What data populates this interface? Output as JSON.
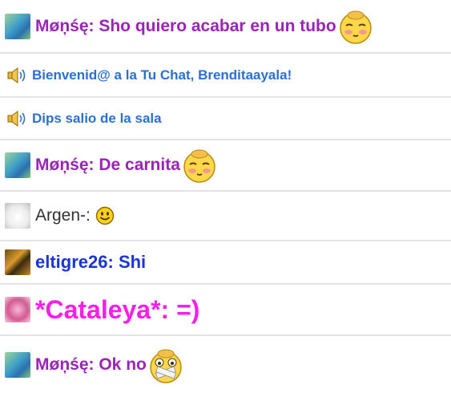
{
  "messages": [
    {
      "type": "user",
      "user": "Møņśę",
      "sep": ":",
      "text": " Sho quiero acabar en un tubo",
      "emoticon": "blushing-smiley-icon"
    },
    {
      "type": "system",
      "text": "Bienvenid@ a la Tu Chat, Brenditaayala!"
    },
    {
      "type": "system",
      "text": "Dips salio de la sala"
    },
    {
      "type": "user",
      "user": "Møņśę",
      "sep": ":",
      "text": " De carnita",
      "emoticon": "blushing-smiley-icon"
    },
    {
      "type": "user",
      "user": "Argen-",
      "sep": ":",
      "text": "",
      "emoticon": "smiley-face-icon"
    },
    {
      "type": "user",
      "user": "eltigre26",
      "sep": ":",
      "text": " Shi"
    },
    {
      "type": "user",
      "user": "*Cataleya*",
      "sep": ":",
      "text": " =)"
    },
    {
      "type": "user",
      "user": "Møņśę",
      "sep": ":",
      "text": " Ok no",
      "emoticon": "taped-mouth-smiley-icon"
    }
  ],
  "colors": {
    "monse": "#9b24b8",
    "system": "#2a6fd6",
    "argen": "#333333",
    "tigre": "#1a34d8",
    "cataleya": "#ff1ee8",
    "divider": "#e3e3e3"
  }
}
